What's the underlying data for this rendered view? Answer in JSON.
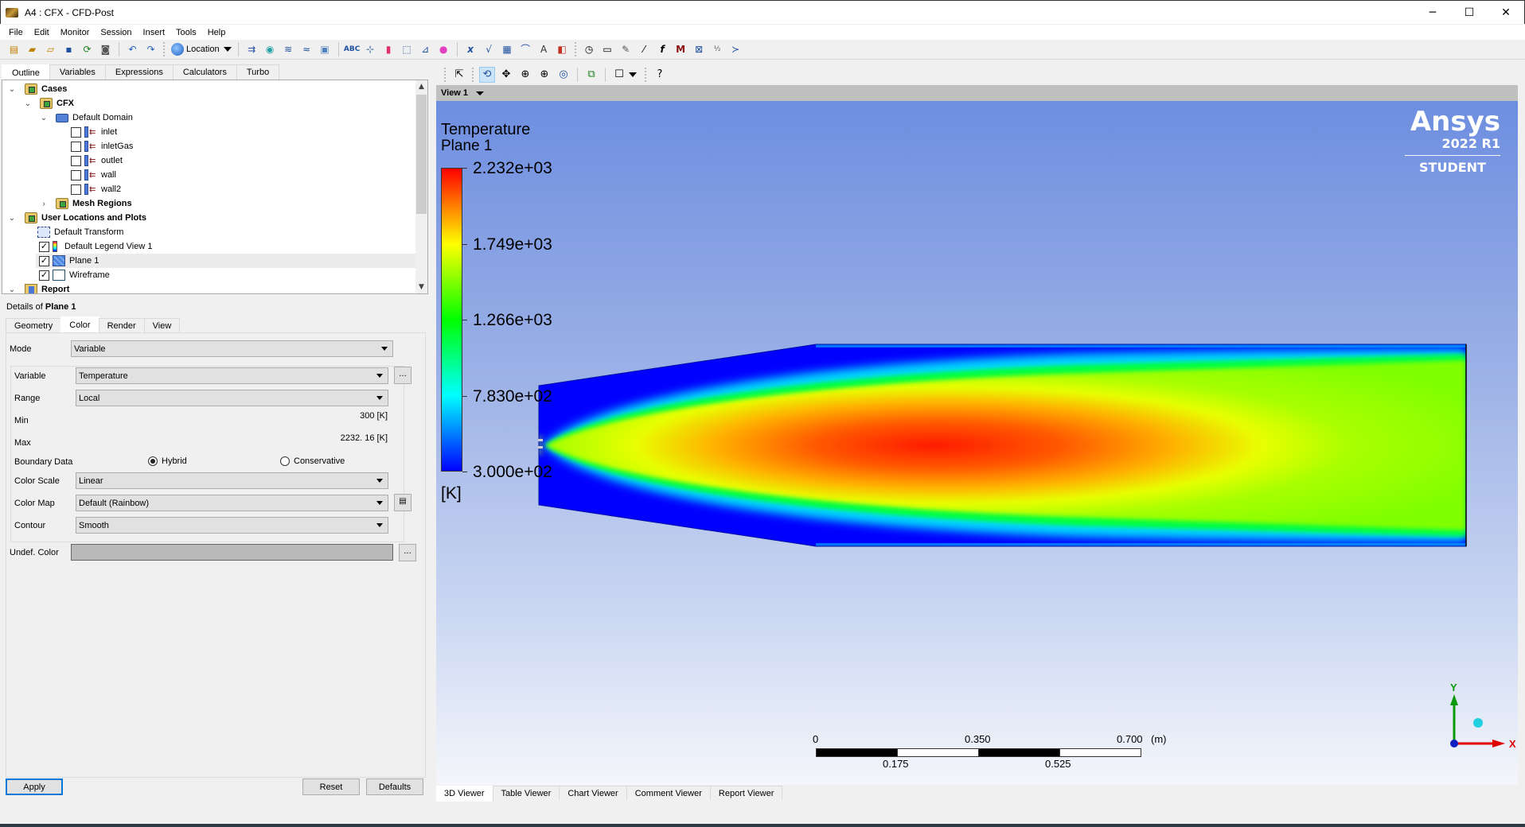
{
  "window": {
    "title": "A4 : CFX - CFD-Post",
    "controls": {
      "minimize": "─",
      "maximize": "☐",
      "close": "✕"
    }
  },
  "menu": [
    "File",
    "Edit",
    "Monitor",
    "Session",
    "Insert",
    "Tools",
    "Help"
  ],
  "toolbar": {
    "location_label": "Location",
    "icons_left": [
      "new-file-icon",
      "load-state-icon",
      "load-results-icon",
      "save-state-icon",
      "refresh-icon",
      "screenshot-icon"
    ],
    "icons_undo": [
      "undo-icon",
      "redo-icon"
    ],
    "icons_insert": [
      "vector-icon",
      "contour-icon",
      "streamline-icon",
      "particle-track-icon",
      "volume-rendering-icon",
      "text-icon",
      "coordinate-frame-icon",
      "legend-icon",
      "instance-transform-icon",
      "clip-plane-icon",
      "color-map-icon",
      "variable-icon",
      "expression-icon",
      "table-icon",
      "chart-icon",
      "comment-icon",
      "figure-icon"
    ],
    "icons_tools": [
      "timestep-icon",
      "animation-icon",
      "quick-editor-icon",
      "probe-icon",
      "function-calculator-icon",
      "macro-calculator-icon",
      "mesh-calculator-icon",
      "case-comparison-icon",
      "command-editor-icon"
    ]
  },
  "left_tabs": [
    {
      "label": "Outline",
      "active": true
    },
    {
      "label": "Variables",
      "active": false
    },
    {
      "label": "Expressions",
      "active": false
    },
    {
      "label": "Calculators",
      "active": false
    },
    {
      "label": "Turbo",
      "active": false
    }
  ],
  "tree": [
    {
      "label": "Cases",
      "level": 0,
      "expanded": true,
      "bold": true,
      "icon": "cases-folder-icon"
    },
    {
      "label": "CFX",
      "level": 1,
      "expanded": true,
      "bold": true,
      "icon": "case-icon"
    },
    {
      "label": "Default Domain",
      "level": 2,
      "expanded": true,
      "bold": false,
      "icon": "domain-icon"
    },
    {
      "label": "inlet",
      "level": 3,
      "checked": false,
      "icon": "boundary-icon"
    },
    {
      "label": "inletGas",
      "level": 3,
      "checked": false,
      "icon": "boundary-icon"
    },
    {
      "label": "outlet",
      "level": 3,
      "checked": false,
      "icon": "boundary-icon"
    },
    {
      "label": "wall",
      "level": 3,
      "checked": false,
      "icon": "boundary-icon"
    },
    {
      "label": "wall2",
      "level": 3,
      "checked": false,
      "icon": "boundary-icon"
    },
    {
      "label": "Mesh Regions",
      "level": 2,
      "expanded": false,
      "bold": true,
      "icon": "mesh-regions-icon"
    },
    {
      "label": "User Locations and Plots",
      "level": 0,
      "expanded": true,
      "bold": true,
      "icon": "user-locations-folder-icon"
    },
    {
      "label": "Default Transform",
      "level": 1,
      "icon": "transform-icon"
    },
    {
      "label": "Default Legend View 1",
      "level": 1,
      "checked": true,
      "icon": "legend-icon"
    },
    {
      "label": "Plane 1",
      "level": 1,
      "checked": true,
      "selected": true,
      "icon": "plane-icon"
    },
    {
      "label": "Wireframe",
      "level": 1,
      "checked": true,
      "icon": "wireframe-icon"
    },
    {
      "label": "Report",
      "level": 0,
      "expanded": true,
      "bold": true,
      "icon": "report-icon"
    }
  ],
  "details": {
    "prefix": "Details of ",
    "object": "Plane 1",
    "tabs": [
      {
        "label": "Geometry",
        "active": false
      },
      {
        "label": "Color",
        "active": true
      },
      {
        "label": "Render",
        "active": false
      },
      {
        "label": "View",
        "active": false
      }
    ],
    "mode_label": "Mode",
    "mode_value": "Variable",
    "variable_label": "Variable",
    "variable_value": "Temperature",
    "range_label": "Range",
    "range_value": "Local",
    "min_label": "Min",
    "min_value": "300 [K]",
    "max_label": "Max",
    "max_value": "2232. 16 [K]",
    "boundary_label": "Boundary Data",
    "boundary_options": [
      {
        "label": "Hybrid",
        "selected": true
      },
      {
        "label": "Conservative",
        "selected": false
      }
    ],
    "color_scale_label": "Color Scale",
    "color_scale_value": "Linear",
    "color_map_label": "Color Map",
    "color_map_value": "Default (Rainbow)",
    "contour_label": "Contour",
    "contour_value": "Smooth",
    "undef_color_label": "Undef. Color",
    "undef_color": "#b9b9b9",
    "ellipsis": "...",
    "apply": "Apply",
    "reset": "Reset",
    "defaults": "Defaults"
  },
  "viewer": {
    "view_name": "View 1",
    "tool_icons": [
      "select-icon",
      "rotate-icon",
      "pan-icon",
      "zoom-box-icon",
      "zoom-icon",
      "zoom-fit-icon",
      "fit-view-icon",
      "viewport-layout-icon",
      "help-icon"
    ],
    "legend": {
      "title": "Temperature",
      "subtitle": "Plane 1",
      "ticks": [
        "2.232e+03",
        "1.749e+03",
        "1.266e+03",
        "7.830e+02",
        "3.000e+02"
      ],
      "tick_values": [
        2232,
        1749,
        1266,
        783,
        300
      ],
      "unit": "[K]",
      "min": 300,
      "max": 2232.16
    },
    "brand": {
      "name": "Ansys",
      "version": "2022 R1",
      "edition": "STUDENT"
    },
    "scale_bar": {
      "top_labels": [
        "0",
        "0.350",
        "0.700"
      ],
      "bottom_labels": [
        "0.175",
        "0.525"
      ],
      "unit": "(m)"
    },
    "axes": {
      "x": "X",
      "y": "Y"
    },
    "bottom_tabs": [
      {
        "label": "3D Viewer",
        "active": true
      },
      {
        "label": "Table Viewer",
        "active": false
      },
      {
        "label": "Chart Viewer",
        "active": false
      },
      {
        "label": "Comment Viewer",
        "active": false
      },
      {
        "label": "Report Viewer",
        "active": false
      }
    ]
  }
}
